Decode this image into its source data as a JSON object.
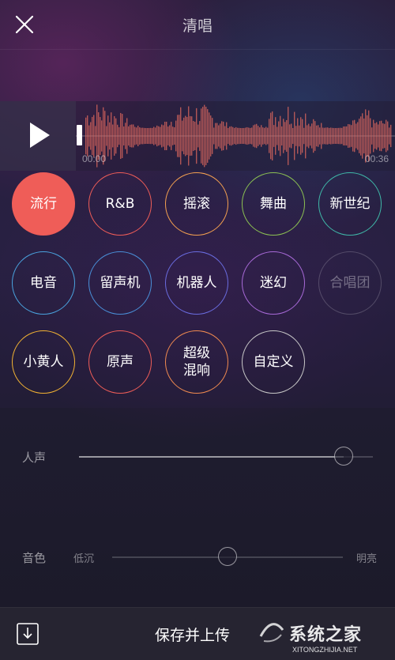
{
  "header": {
    "title": "清唱",
    "close_icon": "close-icon"
  },
  "player": {
    "play_icon": "play-icon",
    "time_start": "00:00",
    "time_end": "00:36",
    "waveform_color": "#e0685e",
    "progress": 0.0
  },
  "effects": [
    {
      "label": "流行",
      "color": "#ef5d58",
      "active": true
    },
    {
      "label": "R&B",
      "color": "#ef5d58",
      "active": false
    },
    {
      "label": "摇滚",
      "color": "#f4a050",
      "active": false
    },
    {
      "label": "舞曲",
      "color": "#8cc152",
      "active": false
    },
    {
      "label": "新世纪",
      "color": "#3fb8a8",
      "active": false
    },
    {
      "label": "电音",
      "color": "#4aa3df",
      "active": false
    },
    {
      "label": "留声机",
      "color": "#4a90d9",
      "active": false
    },
    {
      "label": "机器人",
      "color": "#6a6ce0",
      "active": false
    },
    {
      "label": "迷幻",
      "color": "#a86ad8",
      "active": false
    },
    {
      "label": "合唱团",
      "color": "#888888",
      "active": false,
      "disabled": true
    },
    {
      "label": "小黄人",
      "color": "#f2b233",
      "active": false
    },
    {
      "label": "原声",
      "color": "#ef5d58",
      "active": false
    },
    {
      "label": "超级\n混响",
      "color": "#f08a50",
      "active": false
    },
    {
      "label": "自定义",
      "color": "#c8c8c8",
      "active": false
    }
  ],
  "vocal": {
    "label": "人声",
    "value": 0.9
  },
  "timbre": {
    "label": "音色",
    "low_label": "低沉",
    "high_label": "明亮",
    "value": 0.5
  },
  "bottom": {
    "download_icon": "download-icon",
    "save_label": "保存并上传",
    "watermark_main": "系统之家",
    "watermark_sub": "XITONGZHIJIA.NET"
  }
}
